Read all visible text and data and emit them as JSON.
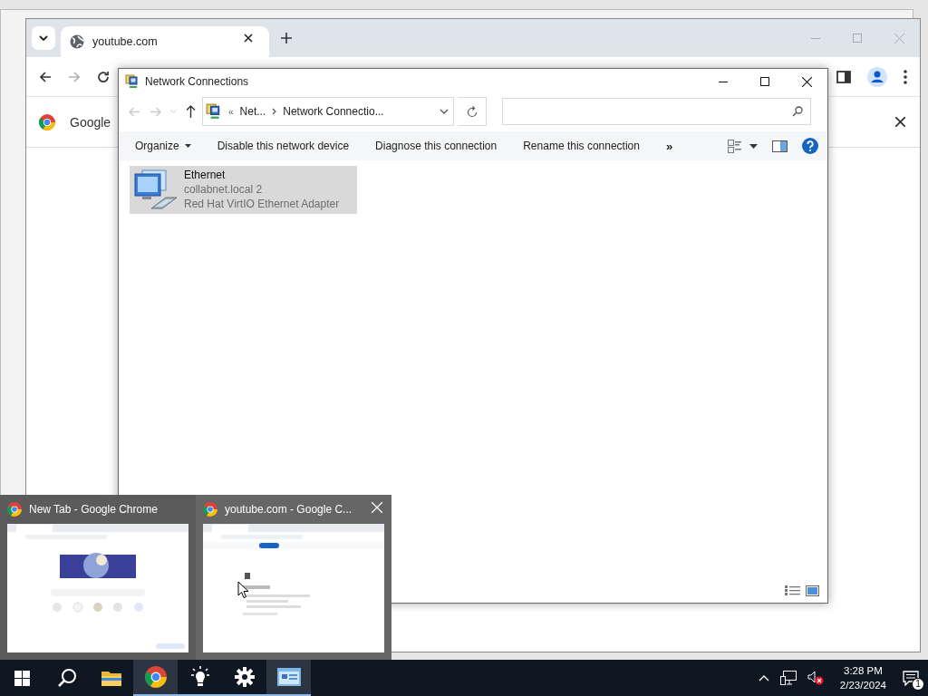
{
  "browser": {
    "tab": {
      "title": "youtube.com",
      "selected": true
    },
    "infobar": {
      "text": "Google"
    }
  },
  "explorer": {
    "title": "Network Connections",
    "address": {
      "overflow": "«",
      "parts": [
        "Net...",
        "Network Connectio..."
      ]
    },
    "commands": [
      {
        "label": "Organize",
        "kind": "menu"
      },
      {
        "label": "Disable this network device",
        "kind": "action"
      },
      {
        "label": "Diagnose this connection",
        "kind": "action"
      },
      {
        "label": "Rename this connection",
        "kind": "action"
      },
      {
        "label": "»",
        "kind": "overflow"
      }
    ],
    "items": [
      {
        "name": "Ethernet",
        "network": "collabnet.local 2",
        "device": "Red Hat VirtIO Ethernet Adapter",
        "selected": true
      }
    ]
  },
  "previews": [
    {
      "title": "New Tab - Google Chrome",
      "hovered": false,
      "kind": "doodle"
    },
    {
      "title": "youtube.com - Google C...",
      "hovered": true,
      "kind": "offline"
    }
  ],
  "taskbar": {
    "apps": [
      {
        "kind": "start",
        "running": false,
        "active": false
      },
      {
        "kind": "search",
        "running": false,
        "active": false
      },
      {
        "kind": "folder",
        "running": false,
        "active": false
      },
      {
        "kind": "chrome",
        "running": true,
        "active": true
      },
      {
        "kind": "bulb",
        "running": true,
        "active": false
      },
      {
        "kind": "gear",
        "running": true,
        "active": false
      },
      {
        "kind": "network",
        "running": true,
        "active": true
      }
    ],
    "time": "3:28 PM",
    "date": "2/23/2024",
    "notifications": "1"
  }
}
